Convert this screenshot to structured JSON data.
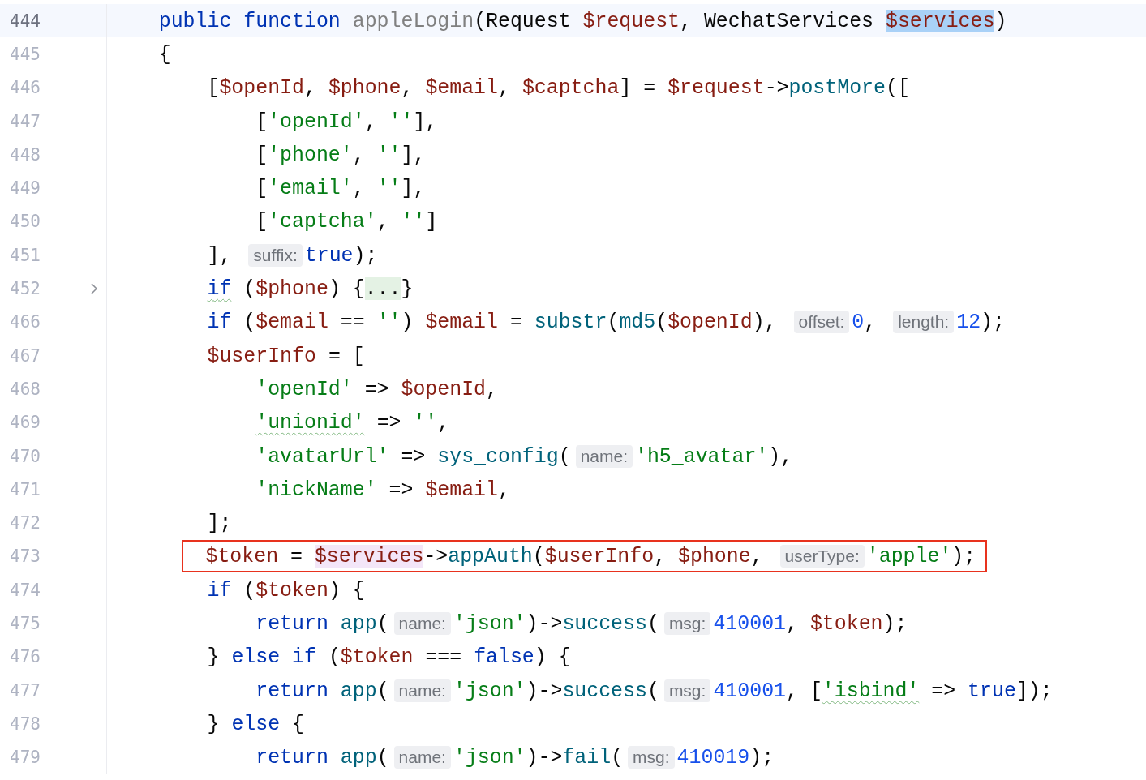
{
  "editor": {
    "lines": [
      {
        "number": "444",
        "current": true,
        "folded": false,
        "boxed": false,
        "tokens": [
          {
            "kind": "keyword",
            "text": "    public "
          },
          {
            "kind": "keyword",
            "text": "function "
          },
          {
            "kind": "unused",
            "text": "appleLogin"
          },
          {
            "kind": "plain",
            "text": "(Request "
          },
          {
            "kind": "variable",
            "text": "$request"
          },
          {
            "kind": "plain",
            "text": ", WechatServices "
          },
          {
            "kind": "variable",
            "text": "$services",
            "highlighted": true,
            "declaration": true
          },
          {
            "kind": "plain",
            "text": ")"
          }
        ]
      },
      {
        "number": "445",
        "current": false,
        "folded": false,
        "boxed": false,
        "tokens": [
          {
            "kind": "plain",
            "text": "    {"
          }
        ]
      },
      {
        "number": "446",
        "current": false,
        "folded": false,
        "boxed": false,
        "tokens": [
          {
            "kind": "plain",
            "text": "        ["
          },
          {
            "kind": "variable",
            "text": "$openId"
          },
          {
            "kind": "plain",
            "text": ", "
          },
          {
            "kind": "variable",
            "text": "$phone"
          },
          {
            "kind": "plain",
            "text": ", "
          },
          {
            "kind": "variable",
            "text": "$email"
          },
          {
            "kind": "plain",
            "text": ", "
          },
          {
            "kind": "variable",
            "text": "$captcha"
          },
          {
            "kind": "plain",
            "text": "] = "
          },
          {
            "kind": "variable",
            "text": "$request"
          },
          {
            "kind": "plain",
            "text": "->"
          },
          {
            "kind": "call",
            "text": "postMore"
          },
          {
            "kind": "plain",
            "text": "(["
          }
        ]
      },
      {
        "number": "447",
        "current": false,
        "folded": false,
        "boxed": false,
        "tokens": [
          {
            "kind": "plain",
            "text": "            ["
          },
          {
            "kind": "string",
            "text": "'openId'"
          },
          {
            "kind": "plain",
            "text": ", "
          },
          {
            "kind": "string",
            "text": "''"
          },
          {
            "kind": "plain",
            "text": "],"
          }
        ]
      },
      {
        "number": "448",
        "current": false,
        "folded": false,
        "boxed": false,
        "tokens": [
          {
            "kind": "plain",
            "text": "            ["
          },
          {
            "kind": "string",
            "text": "'phone'"
          },
          {
            "kind": "plain",
            "text": ", "
          },
          {
            "kind": "string",
            "text": "''"
          },
          {
            "kind": "plain",
            "text": "],"
          }
        ]
      },
      {
        "number": "449",
        "current": false,
        "folded": false,
        "boxed": false,
        "tokens": [
          {
            "kind": "plain",
            "text": "            ["
          },
          {
            "kind": "string",
            "text": "'email'"
          },
          {
            "kind": "plain",
            "text": ", "
          },
          {
            "kind": "string",
            "text": "''"
          },
          {
            "kind": "plain",
            "text": "],"
          }
        ]
      },
      {
        "number": "450",
        "current": false,
        "folded": false,
        "boxed": false,
        "tokens": [
          {
            "kind": "plain",
            "text": "            ["
          },
          {
            "kind": "string",
            "text": "'captcha'"
          },
          {
            "kind": "plain",
            "text": ", "
          },
          {
            "kind": "string",
            "text": "''"
          },
          {
            "kind": "plain",
            "text": "]"
          }
        ]
      },
      {
        "number": "451",
        "current": false,
        "folded": false,
        "boxed": false,
        "tokens": [
          {
            "kind": "plain",
            "text": "        ], "
          },
          {
            "kind": "hint",
            "text": "suffix:"
          },
          {
            "kind": "keyword",
            "text": "true"
          },
          {
            "kind": "plain",
            "text": ");"
          }
        ]
      },
      {
        "number": "452",
        "current": false,
        "folded": true,
        "boxed": false,
        "tokens": [
          {
            "kind": "keyword",
            "text": "        if",
            "warning": true
          },
          {
            "kind": "plain",
            "text": " ("
          },
          {
            "kind": "variable",
            "text": "$phone"
          },
          {
            "kind": "plain",
            "text": ") {"
          },
          {
            "kind": "fold",
            "text": "..."
          },
          {
            "kind": "plain",
            "text": "}"
          }
        ]
      },
      {
        "number": "466",
        "current": false,
        "folded": false,
        "boxed": false,
        "tokens": [
          {
            "kind": "keyword",
            "text": "        if"
          },
          {
            "kind": "plain",
            "text": " ("
          },
          {
            "kind": "variable",
            "text": "$email"
          },
          {
            "kind": "plain",
            "text": " == "
          },
          {
            "kind": "string",
            "text": "''"
          },
          {
            "kind": "plain",
            "text": ") "
          },
          {
            "kind": "variable",
            "text": "$email"
          },
          {
            "kind": "plain",
            "text": " = "
          },
          {
            "kind": "call",
            "text": "substr"
          },
          {
            "kind": "plain",
            "text": "("
          },
          {
            "kind": "call",
            "text": "md5"
          },
          {
            "kind": "plain",
            "text": "("
          },
          {
            "kind": "variable",
            "text": "$openId"
          },
          {
            "kind": "plain",
            "text": "), "
          },
          {
            "kind": "hint",
            "text": "offset:"
          },
          {
            "kind": "number",
            "text": "0"
          },
          {
            "kind": "plain",
            "text": ", "
          },
          {
            "kind": "hint",
            "text": "length:"
          },
          {
            "kind": "number",
            "text": "12"
          },
          {
            "kind": "plain",
            "text": ");"
          }
        ]
      },
      {
        "number": "467",
        "current": false,
        "folded": false,
        "boxed": false,
        "tokens": [
          {
            "kind": "variable",
            "text": "        $userInfo"
          },
          {
            "kind": "plain",
            "text": " = ["
          }
        ]
      },
      {
        "number": "468",
        "current": false,
        "folded": false,
        "boxed": false,
        "tokens": [
          {
            "kind": "string",
            "text": "            'openId'"
          },
          {
            "kind": "plain",
            "text": " => "
          },
          {
            "kind": "variable",
            "text": "$openId"
          },
          {
            "kind": "plain",
            "text": ","
          }
        ]
      },
      {
        "number": "469",
        "current": false,
        "folded": false,
        "boxed": false,
        "tokens": [
          {
            "kind": "string",
            "text": "            'unionid'",
            "warning": true
          },
          {
            "kind": "plain",
            "text": " => "
          },
          {
            "kind": "string",
            "text": "''"
          },
          {
            "kind": "plain",
            "text": ","
          }
        ]
      },
      {
        "number": "470",
        "current": false,
        "folded": false,
        "boxed": false,
        "tokens": [
          {
            "kind": "string",
            "text": "            'avatarUrl'"
          },
          {
            "kind": "plain",
            "text": " => "
          },
          {
            "kind": "call",
            "text": "sys_config"
          },
          {
            "kind": "plain",
            "text": "("
          },
          {
            "kind": "hint",
            "text": "name:"
          },
          {
            "kind": "string",
            "text": "'h5_avatar'"
          },
          {
            "kind": "plain",
            "text": "),"
          }
        ]
      },
      {
        "number": "471",
        "current": false,
        "folded": false,
        "boxed": false,
        "tokens": [
          {
            "kind": "string",
            "text": "            'nickName'"
          },
          {
            "kind": "plain",
            "text": " => "
          },
          {
            "kind": "variable",
            "text": "$email"
          },
          {
            "kind": "plain",
            "text": ","
          }
        ]
      },
      {
        "number": "472",
        "current": false,
        "folded": false,
        "boxed": false,
        "tokens": [
          {
            "kind": "plain",
            "text": "        ];"
          }
        ]
      },
      {
        "number": "473",
        "current": false,
        "folded": false,
        "boxed": true,
        "tokens": [
          {
            "kind": "variable",
            "text": "        $token"
          },
          {
            "kind": "plain",
            "text": " = "
          },
          {
            "kind": "variable",
            "text": "$services",
            "highlighted": true,
            "declaration": false
          },
          {
            "kind": "plain",
            "text": "->"
          },
          {
            "kind": "call",
            "text": "appAuth"
          },
          {
            "kind": "plain",
            "text": "("
          },
          {
            "kind": "variable",
            "text": "$userInfo"
          },
          {
            "kind": "plain",
            "text": ", "
          },
          {
            "kind": "variable",
            "text": "$phone"
          },
          {
            "kind": "plain",
            "text": ", "
          },
          {
            "kind": "hint",
            "text": "userType:"
          },
          {
            "kind": "string",
            "text": "'apple'"
          },
          {
            "kind": "plain",
            "text": ");"
          }
        ]
      },
      {
        "number": "474",
        "current": false,
        "folded": false,
        "boxed": false,
        "tokens": [
          {
            "kind": "keyword",
            "text": "        if"
          },
          {
            "kind": "plain",
            "text": " ("
          },
          {
            "kind": "variable",
            "text": "$token"
          },
          {
            "kind": "plain",
            "text": ") {"
          }
        ]
      },
      {
        "number": "475",
        "current": false,
        "folded": false,
        "boxed": false,
        "tokens": [
          {
            "kind": "keyword",
            "text": "            return "
          },
          {
            "kind": "call",
            "text": "app"
          },
          {
            "kind": "plain",
            "text": "("
          },
          {
            "kind": "hint",
            "text": "name:"
          },
          {
            "kind": "string",
            "text": "'json'"
          },
          {
            "kind": "plain",
            "text": ")->"
          },
          {
            "kind": "call",
            "text": "success"
          },
          {
            "kind": "plain",
            "text": "("
          },
          {
            "kind": "hint",
            "text": "msg:"
          },
          {
            "kind": "number",
            "text": "410001"
          },
          {
            "kind": "plain",
            "text": ", "
          },
          {
            "kind": "variable",
            "text": "$token"
          },
          {
            "kind": "plain",
            "text": ");"
          }
        ]
      },
      {
        "number": "476",
        "current": false,
        "folded": false,
        "boxed": false,
        "tokens": [
          {
            "kind": "plain",
            "text": "        } "
          },
          {
            "kind": "keyword",
            "text": "else "
          },
          {
            "kind": "keyword",
            "text": "if"
          },
          {
            "kind": "plain",
            "text": " ("
          },
          {
            "kind": "variable",
            "text": "$token"
          },
          {
            "kind": "plain",
            "text": " === "
          },
          {
            "kind": "keyword",
            "text": "false"
          },
          {
            "kind": "plain",
            "text": ") {"
          }
        ]
      },
      {
        "number": "477",
        "current": false,
        "folded": false,
        "boxed": false,
        "tokens": [
          {
            "kind": "keyword",
            "text": "            return "
          },
          {
            "kind": "call",
            "text": "app"
          },
          {
            "kind": "plain",
            "text": "("
          },
          {
            "kind": "hint",
            "text": "name:"
          },
          {
            "kind": "string",
            "text": "'json'"
          },
          {
            "kind": "plain",
            "text": ")->"
          },
          {
            "kind": "call",
            "text": "success"
          },
          {
            "kind": "plain",
            "text": "("
          },
          {
            "kind": "hint",
            "text": "msg:"
          },
          {
            "kind": "number",
            "text": "410001"
          },
          {
            "kind": "plain",
            "text": ", ["
          },
          {
            "kind": "string",
            "text": "'isbind'",
            "warning": true
          },
          {
            "kind": "plain",
            "text": " => "
          },
          {
            "kind": "keyword",
            "text": "true"
          },
          {
            "kind": "plain",
            "text": "]);"
          }
        ]
      },
      {
        "number": "478",
        "current": false,
        "folded": false,
        "boxed": false,
        "tokens": [
          {
            "kind": "plain",
            "text": "        } "
          },
          {
            "kind": "keyword",
            "text": "else"
          },
          {
            "kind": "plain",
            "text": " {"
          }
        ]
      },
      {
        "number": "479",
        "current": false,
        "folded": false,
        "boxed": false,
        "tokens": [
          {
            "kind": "keyword",
            "text": "            return "
          },
          {
            "kind": "call",
            "text": "app"
          },
          {
            "kind": "plain",
            "text": "("
          },
          {
            "kind": "hint",
            "text": "name:"
          },
          {
            "kind": "string",
            "text": "'json'"
          },
          {
            "kind": "plain",
            "text": ")->"
          },
          {
            "kind": "call",
            "text": "fail"
          },
          {
            "kind": "plain",
            "text": "("
          },
          {
            "kind": "hint",
            "text": "msg:"
          },
          {
            "kind": "number",
            "text": "410019"
          },
          {
            "kind": "plain",
            "text": ");"
          }
        ]
      }
    ]
  }
}
